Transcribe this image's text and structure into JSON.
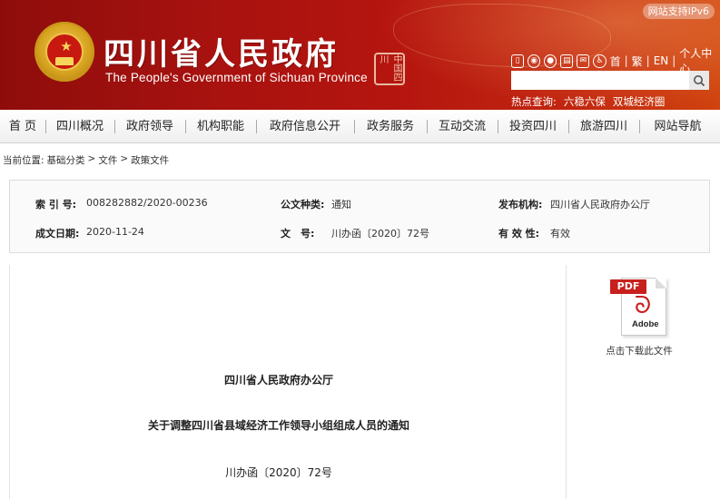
{
  "header": {
    "title": "四川省人民政府",
    "subtitle": "The People's Government of Sichuan Province",
    "seal_text": "中国四川",
    "ipv6_badge": "网站支持IPv6",
    "tools": {
      "home": "首",
      "traditional": "繁",
      "en": "EN",
      "personal": "个人中心"
    },
    "search": {
      "placeholder": ""
    },
    "hot_search": {
      "label": "热点查询:",
      "items": [
        "六稳六保",
        "双城经济圈"
      ]
    }
  },
  "nav": {
    "items": [
      "首 页",
      "四川概况",
      "政府领导",
      "机构职能",
      "政府信息公开",
      "政务服务",
      "互动交流",
      "投资四川",
      "旅游四川",
      "网站导航"
    ]
  },
  "breadcrumb": {
    "items": [
      "当前位置:",
      "基础分类",
      ">",
      "文件",
      ">",
      "政策文件"
    ]
  },
  "info": {
    "index_label": "索 引 号:",
    "index_value": "008282882/2020-00236",
    "doc_type_label": "公文种类:",
    "doc_type_value": "通知",
    "publisher_label": "发布机构:",
    "publisher_value": "四川省人民政府办公厅",
    "date_label": "成文日期:",
    "date_value": "2020-11-24",
    "number_label": "文　号:",
    "number_value": "川办函〔2020〕72号",
    "validity_label": "有 效 性:",
    "validity_value": "有效"
  },
  "document": {
    "issuer": "四川省人民政府办公厅",
    "title": "关于调整四川省县域经济工作领导小组组成人员的通知",
    "number": "川办函〔2020〕72号"
  },
  "pdf": {
    "tag": "PDF",
    "brand": "Adobe",
    "label": "点击下载此文件"
  }
}
